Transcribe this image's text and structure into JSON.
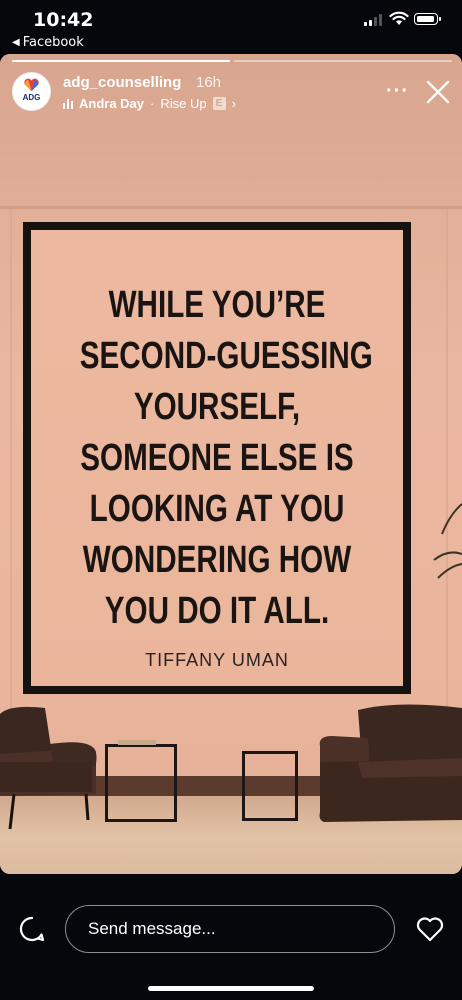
{
  "status": {
    "time": "10:42",
    "back_app": "Facebook"
  },
  "story": {
    "progress": {
      "segments": 2,
      "current": 1
    },
    "account": {
      "username": "adg_counselling",
      "ago": "16h",
      "avatar_abbr": "ADG"
    },
    "music": {
      "artist": "Andra Day",
      "separator": "·",
      "song": "Rise Up",
      "explicit_badge": "E",
      "chevron": "›"
    },
    "more_icon": "more-dots-icon",
    "close_icon": "close-icon",
    "poster": {
      "quote_lines": [
        "WHILE YOU’RE",
        "SECOND-GUESSING",
        "YOURSELF,",
        "SOMEONE ELSE IS",
        "LOOKING AT YOU",
        "WONDERING HOW",
        "YOU DO IT ALL."
      ],
      "author": "TIFFANY UMAN"
    }
  },
  "footer": {
    "message_placeholder": "Send message...",
    "reply_icon": "chat-bubble-icon",
    "like_icon": "heart-icon"
  },
  "colors": {
    "background": "#05070c",
    "wall": "#e8b59c",
    "poster_text": "#1a1413",
    "frame": "#161210"
  }
}
